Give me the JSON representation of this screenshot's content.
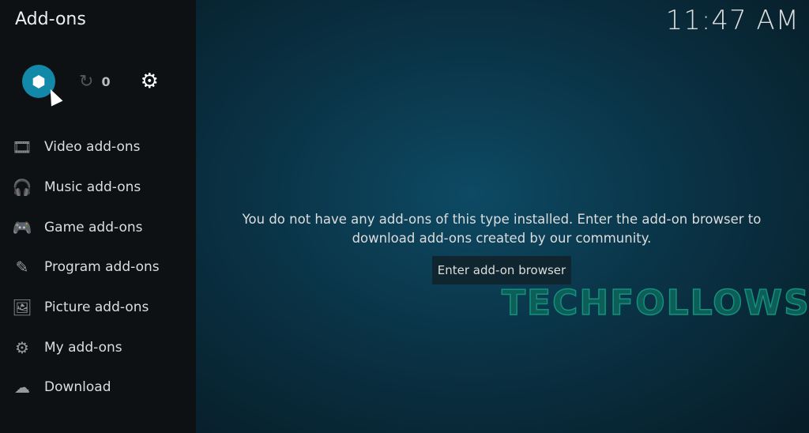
{
  "header": {
    "title": "Add-ons",
    "clock": "11:47 AM"
  },
  "toolbar": {
    "browser_icon": "open-box-icon",
    "update_icon": "refresh-icon",
    "update_count": "0",
    "settings_icon": "gear-icon"
  },
  "sidebar": {
    "items": [
      {
        "label": "Video add-ons",
        "icon": "film-icon",
        "glyph": "🎞"
      },
      {
        "label": "Music add-ons",
        "icon": "headphones-icon",
        "glyph": "🎧"
      },
      {
        "label": "Game add-ons",
        "icon": "gamepad-icon",
        "glyph": "🎮"
      },
      {
        "label": "Program add-ons",
        "icon": "tools-icon",
        "glyph": "✎"
      },
      {
        "label": "Picture add-ons",
        "icon": "picture-icon",
        "glyph": "🖼"
      },
      {
        "label": "My add-ons",
        "icon": "cogs-icon",
        "glyph": "⚙"
      },
      {
        "label": "Download",
        "icon": "cloud-download-icon",
        "glyph": "☁"
      }
    ]
  },
  "main": {
    "message": "You do not have any add-ons of this type installed. Enter the add-on browser to download add-ons created by our community.",
    "button": "Enter add-on browser",
    "watermark": "TECHFOLLOWS"
  },
  "colors": {
    "accent": "#1289a8"
  }
}
